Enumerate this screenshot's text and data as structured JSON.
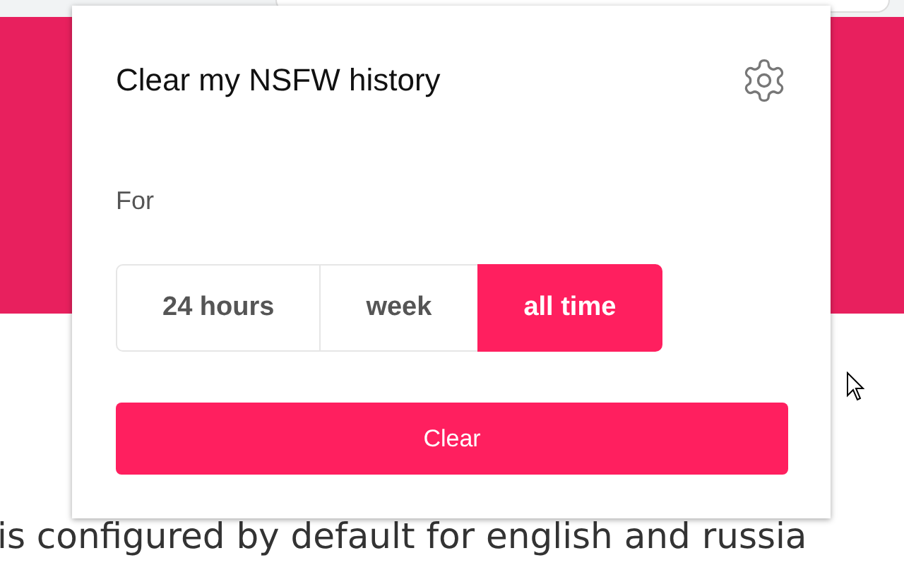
{
  "page": {
    "text": "is configured by default for english and russia"
  },
  "popup": {
    "title": "Clear my NSFW history",
    "label": "For",
    "periods": [
      {
        "label": "24 hours",
        "selected": false
      },
      {
        "label": "week",
        "selected": false
      },
      {
        "label": "all time",
        "selected": true
      }
    ],
    "button": "Clear"
  }
}
